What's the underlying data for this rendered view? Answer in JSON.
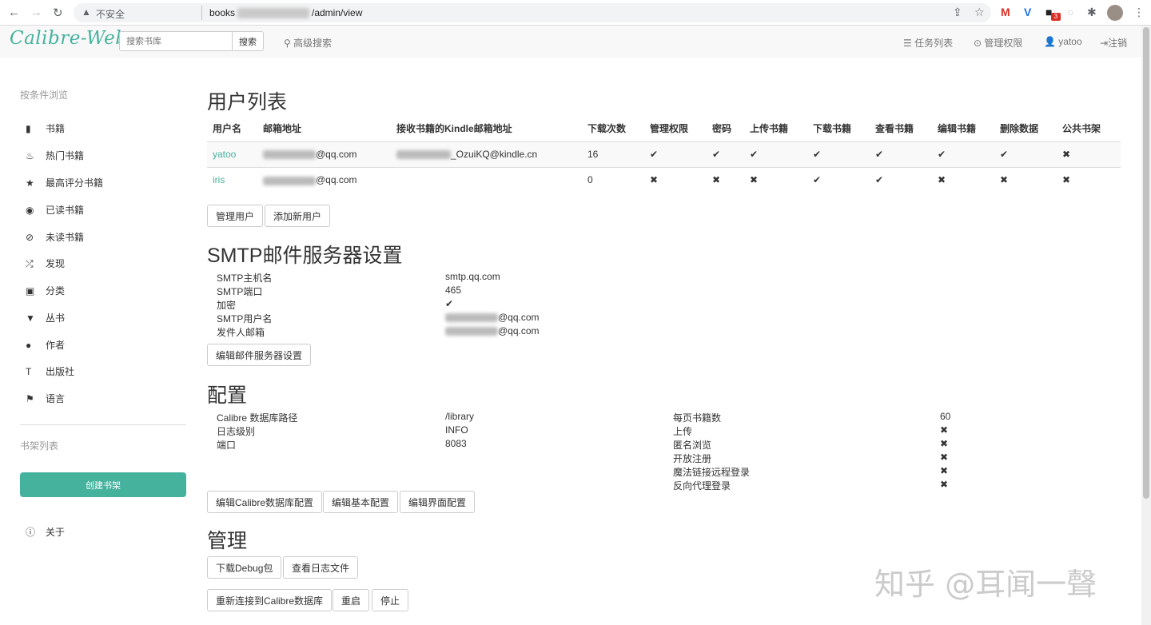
{
  "browser": {
    "insecure_label": "不安全",
    "url_prefix": "books",
    "url_suffix": "/admin/view",
    "ext_badge": "3"
  },
  "navbar": {
    "brand": "Calibre-Web",
    "search_placeholder": "搜索书库",
    "search_button": "搜索",
    "advanced_search": "高级搜索",
    "tasks": "任务列表",
    "admin": "管理权限",
    "user": "yatoo",
    "logout": "注销"
  },
  "sidebar": {
    "browse_heading": "按条件浏览",
    "items": [
      {
        "label": "书籍",
        "icon": "book-icon"
      },
      {
        "label": "热门书籍",
        "icon": "fire-icon"
      },
      {
        "label": "最高评分书籍",
        "icon": "star-icon"
      },
      {
        "label": "已读书籍",
        "icon": "eye-icon"
      },
      {
        "label": "未读书籍",
        "icon": "eye-slash-icon"
      },
      {
        "label": "发现",
        "icon": "random-icon"
      },
      {
        "label": "分类",
        "icon": "inbox-icon"
      },
      {
        "label": "丛书",
        "icon": "bookmark-icon"
      },
      {
        "label": "作者",
        "icon": "user-icon"
      },
      {
        "label": "出版社",
        "icon": "text-size-icon"
      },
      {
        "label": "语言",
        "icon": "flag-icon"
      }
    ],
    "shelves_heading": "书架列表",
    "create_shelf": "创建书架",
    "about": "关于"
  },
  "users_section": {
    "title": "用户列表",
    "columns": [
      "用户名",
      "邮箱地址",
      "接收书籍的Kindle邮箱地址",
      "下载次数",
      "管理权限",
      "密码",
      "上传书籍",
      "下载书籍",
      "查看书籍",
      "编辑书籍",
      "删除数据",
      "公共书架"
    ],
    "rows": [
      {
        "name": "yatoo",
        "email": "@qq.com",
        "kindle": "_OzuiKQ@kindle.cn",
        "downloads": "16",
        "perms": [
          "✔",
          "✔",
          "✔",
          "✔",
          "✔",
          "✔",
          "✔",
          "✖"
        ]
      },
      {
        "name": "iris",
        "email": "@qq.com",
        "kindle": "",
        "downloads": "0",
        "perms": [
          "✖",
          "✖",
          "✖",
          "✔",
          "✔",
          "✖",
          "✖",
          "✖"
        ]
      }
    ],
    "manage_users": "管理用户",
    "add_user": "添加新用户"
  },
  "smtp_section": {
    "title": "SMTP邮件服务器设置",
    "host_label": "SMTP主机名",
    "host_value": "smtp.qq.com",
    "port_label": "SMTP端口",
    "port_value": "465",
    "encrypt_label": "加密",
    "encrypt_value": "✔",
    "user_label": "SMTP用户名",
    "user_value": "@qq.com",
    "sender_label": "发件人邮箱",
    "sender_value": "@qq.com",
    "edit_button": "编辑邮件服务器设置"
  },
  "config_section": {
    "title": "配置",
    "db_path_label": "Calibre 数据库路径",
    "db_path_value": "/library",
    "log_level_label": "日志级别",
    "log_level_value": "INFO",
    "port_label": "端口",
    "port_value": "8083",
    "books_per_page_label": "每页书籍数",
    "books_per_page_value": "60",
    "upload_label": "上传",
    "upload_value": "✖",
    "anon_label": "匿名浏览",
    "anon_value": "✖",
    "register_label": "开放注册",
    "register_value": "✖",
    "magic_link_label": "魔法链接远程登录",
    "magic_link_value": "✖",
    "proxy_label": "反向代理登录",
    "proxy_value": "✖",
    "edit_db_button": "编辑Calibre数据库配置",
    "edit_basic_button": "编辑基本配置",
    "edit_ui_button": "编辑界面配置"
  },
  "admin_section": {
    "title": "管理",
    "debug_button": "下载Debug包",
    "logs_button": "查看日志文件",
    "reconnect_button": "重新连接到Calibre数据库",
    "restart_button": "重启",
    "stop_button": "停止"
  },
  "watermark": "知乎 @耳闻一聲",
  "colors": {
    "accent": "#45b29d",
    "navbar_bg": "#f8f8f8"
  }
}
